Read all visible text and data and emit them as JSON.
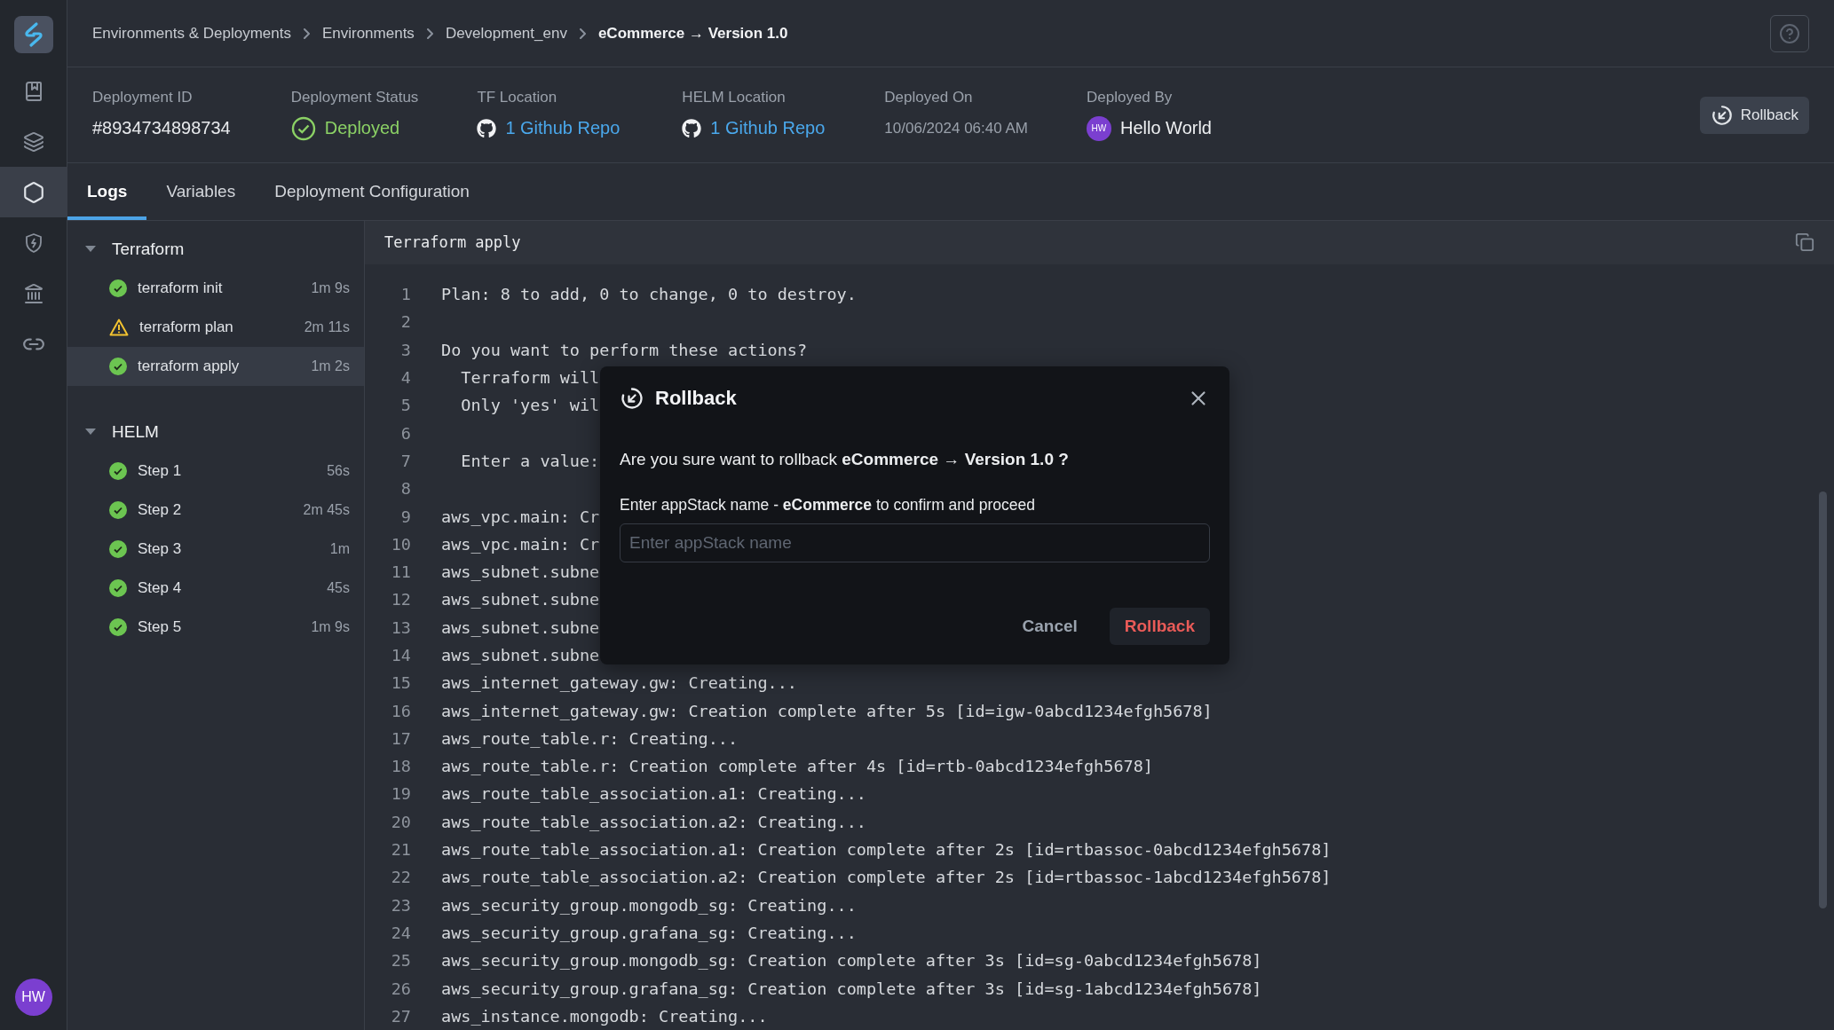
{
  "sidebar": {
    "items": [
      {
        "kind": "book",
        "selected": false
      },
      {
        "kind": "layers",
        "selected": false
      },
      {
        "kind": "hexagon",
        "selected": true
      },
      {
        "kind": "shield",
        "selected": false
      },
      {
        "kind": "bank",
        "selected": false
      },
      {
        "kind": "link",
        "selected": false
      }
    ],
    "avatar": "HW"
  },
  "breadcrumbs": [
    {
      "label": "Environments & Deployments",
      "current": false
    },
    {
      "label": "Environments",
      "current": false
    },
    {
      "label": "Development_env",
      "current": false
    },
    {
      "label": "eCommerce → Version 1.0",
      "current": true
    }
  ],
  "details": [
    {
      "kind": "text",
      "label": "Deployment ID",
      "value": "#8934734898734"
    },
    {
      "kind": "status",
      "label": "Deployment Status",
      "value": "Deployed"
    },
    {
      "kind": "repo",
      "label": "TF Location",
      "value": "1 Github Repo"
    },
    {
      "kind": "repo",
      "label": "HELM Location",
      "value": "1 Github Repo"
    },
    {
      "kind": "date",
      "label": "Deployed On",
      "value": "10/06/2024 06:40 AM"
    },
    {
      "kind": "user",
      "label": "Deployed By",
      "value": "Hello World",
      "initials": "HW"
    }
  ],
  "rollback_button": "Rollback",
  "tabs": [
    {
      "label": "Logs",
      "selected": true
    },
    {
      "label": "Variables",
      "selected": false
    },
    {
      "label": "Deployment Configuration",
      "selected": false
    }
  ],
  "stages": [
    {
      "name": "Terraform",
      "expanded": true,
      "children": [
        {
          "name": "terraform init",
          "duration": "1m 9s",
          "warning": false,
          "selected": false
        },
        {
          "name": "terraform plan",
          "duration": "2m 11s",
          "warning": true,
          "selected": false
        },
        {
          "name": "terraform apply",
          "duration": "1m 2s",
          "warning": false,
          "selected": true
        }
      ]
    },
    {
      "name": "HELM",
      "expanded": true,
      "children": [
        {
          "name": "Step 1",
          "duration": "56s",
          "warning": false,
          "selected": false
        },
        {
          "name": "Step 2",
          "duration": "2m 45s",
          "warning": false,
          "selected": false
        },
        {
          "name": "Step 3",
          "duration": "1m",
          "warning": false,
          "selected": false
        },
        {
          "name": "Step 4",
          "duration": "45s",
          "warning": false,
          "selected": false
        },
        {
          "name": "Step 5",
          "duration": "1m 9s",
          "warning": false,
          "selected": false
        }
      ]
    }
  ],
  "log": {
    "title": "Terraform apply",
    "lines": [
      {
        "number": "1",
        "text": "Plan: 8 to add, 0 to change, 0 to destroy."
      },
      {
        "number": "2"
      },
      {
        "number": "3",
        "text": "Do you want to perform these actions?"
      },
      {
        "number": "4",
        "text": "  Terraform will"
      },
      {
        "number": "5",
        "text": "  Only 'yes' wil"
      },
      {
        "number": "6"
      },
      {
        "number": "7",
        "text": "  Enter a value:"
      },
      {
        "number": "8"
      },
      {
        "number": "9",
        "text": "aws_vpc.main: Cr"
      },
      {
        "number": "10",
        "text": "aws_vpc.main: Cr"
      },
      {
        "number": "11",
        "text": "aws_subnet.subne"
      },
      {
        "number": "12",
        "text": "aws_subnet.subne"
      },
      {
        "number": "13",
        "text": "aws_subnet.subne"
      },
      {
        "number": "14",
        "text": "aws_subnet.subne"
      },
      {
        "number": "15",
        "text": "aws_internet_gateway.gw: Creating..."
      },
      {
        "number": "16",
        "text": "aws_internet_gateway.gw: Creation complete after 5s [id=igw-0abcd1234efgh5678]"
      },
      {
        "number": "17",
        "text": "aws_route_table.r: Creating..."
      },
      {
        "number": "18",
        "text": "aws_route_table.r: Creation complete after 4s [id=rtb-0abcd1234efgh5678]"
      },
      {
        "number": "19",
        "text": "aws_route_table_association.a1: Creating..."
      },
      {
        "number": "20",
        "text": "aws_route_table_association.a2: Creating..."
      },
      {
        "number": "21",
        "text": "aws_route_table_association.a1: Creation complete after 2s [id=rtbassoc-0abcd1234efgh5678]"
      },
      {
        "number": "22",
        "text": "aws_route_table_association.a2: Creation complete after 2s [id=rtbassoc-1abcd1234efgh5678]"
      },
      {
        "number": "23",
        "text": "aws_security_group.mongodb_sg: Creating..."
      },
      {
        "number": "24",
        "text": "aws_security_group.grafana_sg: Creating..."
      },
      {
        "number": "25",
        "text": "aws_security_group.mongodb_sg: Creation complete after 3s [id=sg-0abcd1234efgh5678]"
      },
      {
        "number": "26",
        "text": "aws_security_group.grafana_sg: Creation complete after 3s [id=sg-1abcd1234efgh5678]"
      },
      {
        "number": "27",
        "text": "aws_instance.mongodb: Creating..."
      }
    ]
  },
  "dialog": {
    "title": "Rollback",
    "message": "Are you sure want to rollback **eCommerce  → Version 1.0 ?**",
    "prompt": "Enter appStack name - **eCommerce** to confirm and proceed",
    "input": {
      "placeholder": "Enter appStack name"
    },
    "cancel": "Cancel",
    "confirm": "Rollback"
  }
}
